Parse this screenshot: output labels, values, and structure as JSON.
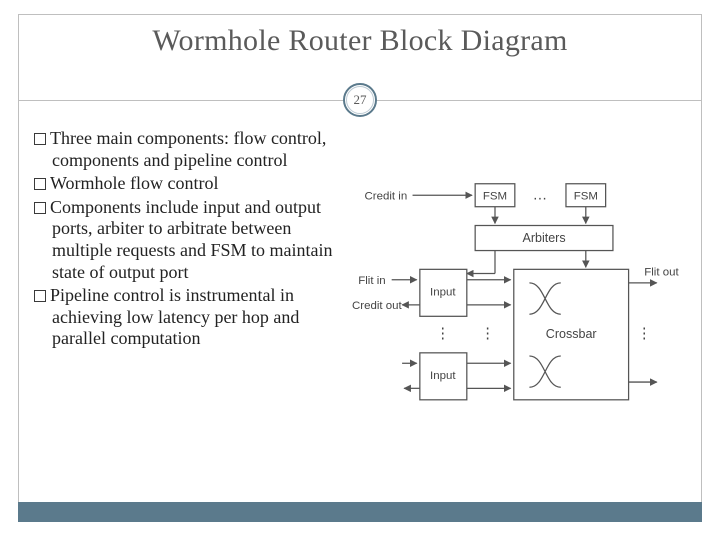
{
  "title": "Wormhole Router Block Diagram",
  "page_number": "27",
  "bullets": [
    "Three main components: flow control, components and pipeline control",
    "Wormhole flow control",
    "Components include input and output ports, arbiter to arbitrate between multiple requests and FSM to maintain state of output port",
    "Pipeline control is instrumental in achieving low latency per hop and parallel computation"
  ],
  "diagram": {
    "signals": {
      "credit_in": "Credit in",
      "flit_in": "Flit in",
      "credit_out": "Credit out",
      "flit_out": "Flit out"
    },
    "blocks": {
      "fsm": "FSM",
      "arbiters": "Arbiters",
      "input": "Input",
      "crossbar": "Crossbar"
    },
    "ellipsis": "…"
  }
}
